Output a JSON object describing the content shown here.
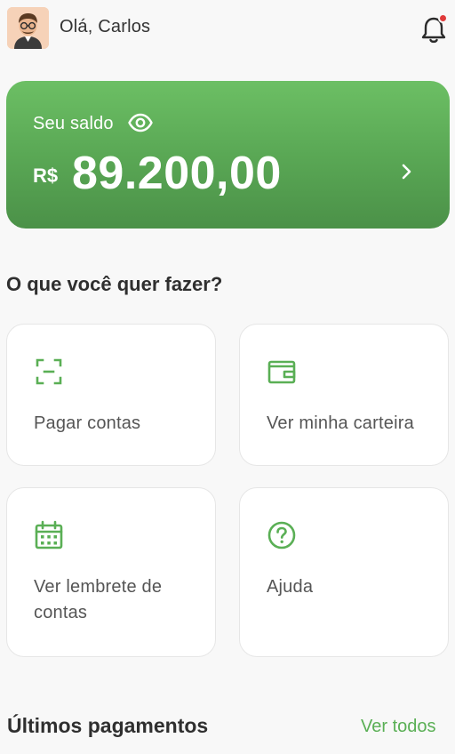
{
  "header": {
    "greeting": "Olá, Carlos",
    "avatar_icon": "avatar-man-icon",
    "notification_icon": "bell-icon",
    "notification_dot_color": "#e03a3a"
  },
  "balance": {
    "label": "Seu saldo",
    "currency": "R$",
    "amount": "89.200,00",
    "visibility_icon": "eye-icon",
    "open_icon": "chevron-right-icon",
    "color": "#5aa855"
  },
  "actions": {
    "title": "O que você quer fazer?",
    "items": [
      {
        "label": "Pagar contas",
        "icon": "scan-icon"
      },
      {
        "label": "Ver minha carteira",
        "icon": "wallet-icon"
      },
      {
        "label": "Ver lembrete de contas",
        "icon": "calendar-icon"
      },
      {
        "label": "Ajuda",
        "icon": "help-circle-icon"
      }
    ],
    "accent": "#5aaf55"
  },
  "recent": {
    "title": "Últimos pagamentos",
    "see_all": "Ver todos"
  }
}
